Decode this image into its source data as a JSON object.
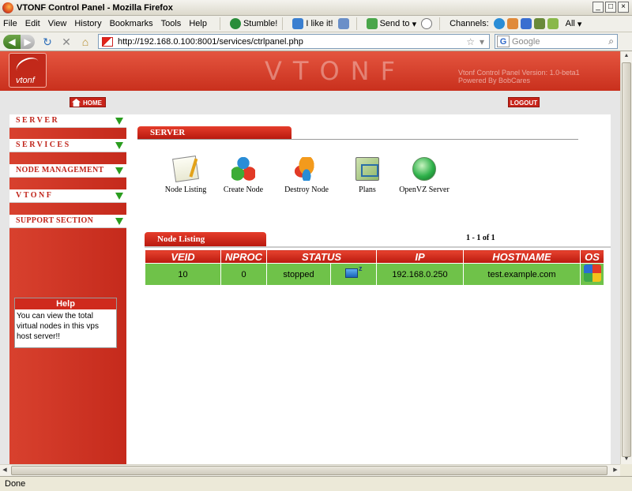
{
  "browser": {
    "window_title": "VTONF Control Panel - Mozilla Firefox",
    "menus": [
      "File",
      "Edit",
      "View",
      "History",
      "Bookmarks",
      "Tools",
      "Help"
    ],
    "toolbar": {
      "stumble": "Stumble!",
      "ilike": "I like it!",
      "sendto": "Send to",
      "channels": "Channels:",
      "all": "All"
    },
    "url": "http://192.168.0.100:8001/services/ctrlpanel.php",
    "search_placeholder": "Google",
    "status": "Done"
  },
  "site": {
    "logo_text": "vtonf",
    "brand": "VTONF",
    "version_line1": "Vtonf Control Panel Version: 1.0-beta1",
    "version_line2": "Powered By BobCares",
    "home": "HOME",
    "logout": "LOGOUT"
  },
  "sidebar": {
    "items": [
      "SERVER",
      "SERVICES",
      "NODE MANAGEMENT",
      "VTONF",
      "SUPPORT SECTION"
    ],
    "help_title": "Help",
    "help_text": "You can view the total virtual nodes in this vps host server!!"
  },
  "main": {
    "section_title": "SERVER",
    "tools": [
      {
        "label": "Node Listing",
        "icon": "notepad-icon"
      },
      {
        "label": "Create Node",
        "icon": "cubes-icon"
      },
      {
        "label": "Destroy Node",
        "icon": "fire-cubes-icon"
      },
      {
        "label": "Plans",
        "icon": "plans-icon"
      },
      {
        "label": "OpenVZ Server",
        "icon": "globe-icon"
      }
    ],
    "list_title": "Node Listing",
    "pager": "1 - 1 of 1",
    "columns": [
      "VEID",
      "NPROC",
      "STATUS",
      "",
      "IP",
      "HOSTNAME",
      "OS"
    ],
    "rows": [
      {
        "veid": "10",
        "nproc": "0",
        "status": "stopped",
        "ip": "192.168.0.250",
        "hostname": "test.example.com"
      }
    ]
  },
  "colors": {
    "accent_red": "#c8251b",
    "row_green": "#6fc249",
    "arrow_green": "#2a9d1f"
  }
}
